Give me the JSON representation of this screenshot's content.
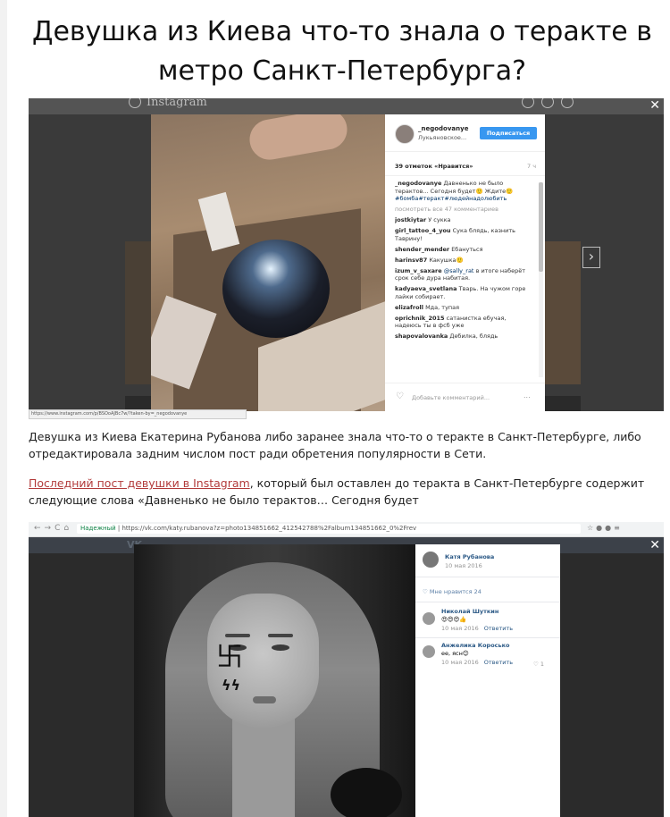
{
  "article": {
    "title": "Девушка из Киева что-то знала о теракте в метро Санкт-Петербурга?",
    "paragraph1": "Девушка из Киева Екатерина Рубанова либо заранее знала что-то о теракте в Санкт-Петербурге, либо отредактировала задним числом пост ради обретения популярности в Сети.",
    "paragraph2_link": "Последний пост девушки в Instagram",
    "paragraph2_rest": ", который был оставлен до теракта в Санкт-Петербурге содержит следующие слова «Давненько не было терактов… Сегодня будет"
  },
  "instagram": {
    "logo": "Instagram",
    "close": "✕",
    "next": "›",
    "username": "_negodovanye",
    "location": "Лукьяновское...",
    "follow_label": "Подписаться",
    "likes": "39 отметок «Нравится»",
    "age": "7 ч",
    "caption_user": "_negodovanye",
    "caption_text": "Давненько не было терактов... Сегодня будет",
    "caption_end": "Ждите",
    "hashtags": "#бомба#теракт#людейнадолюбить",
    "view_all": "посмотреть все 47 комментариев",
    "comments": [
      {
        "user": "jostkiytar",
        "text": "У сукка"
      },
      {
        "user": "girl_tattoo_4_you",
        "text": "Сука блядь, казнить Таврину!"
      },
      {
        "user": "shender_mender",
        "text": "Ебануться"
      },
      {
        "user": "harinsv87",
        "text": "Какушка"
      },
      {
        "user": "izum_v_saxare",
        "mention": "@sally_rat",
        "text": "в итоге наберёт срок себе дура набитая."
      },
      {
        "user": "kadyaeva_svetlana",
        "text": "Тварь. На чужом горе лайки собирает."
      },
      {
        "user": "elizafroll",
        "text": "Мда, тупая"
      },
      {
        "user": "oprichnik_2015",
        "text": "сатанистка ебучая, надеюсь ты в фсб уже"
      },
      {
        "user": "shapovalovanka",
        "text": "Дебилка, блядь"
      }
    ],
    "add_comment": "Добавьте комментарий...",
    "more": "...",
    "url": "https://www.instagram.com/p/BSOoAJBc7w/?taken-by=_negodovanye"
  },
  "vk": {
    "browser_address_secure": "Надежный",
    "browser_address": "https://vk.com/katy.rubanova?z=photo134851662_412542788%2Falbum134851662_0%2Frev",
    "logo": "VK",
    "close": "✕",
    "author": "Катя Рубанова",
    "post_date": "10 мая 2016",
    "likes_label": "Мне нравится",
    "likes_count": "24",
    "comments": [
      {
        "name": "Николай Шуткин",
        "text": "😍😍😍👍",
        "date": "10 мая 2016",
        "reply": "Ответить"
      },
      {
        "name": "Анжелика Коросько",
        "text": "ee, ясн😊",
        "date": "10 мая 2016",
        "reply": "Ответить",
        "likes": "1"
      }
    ]
  }
}
